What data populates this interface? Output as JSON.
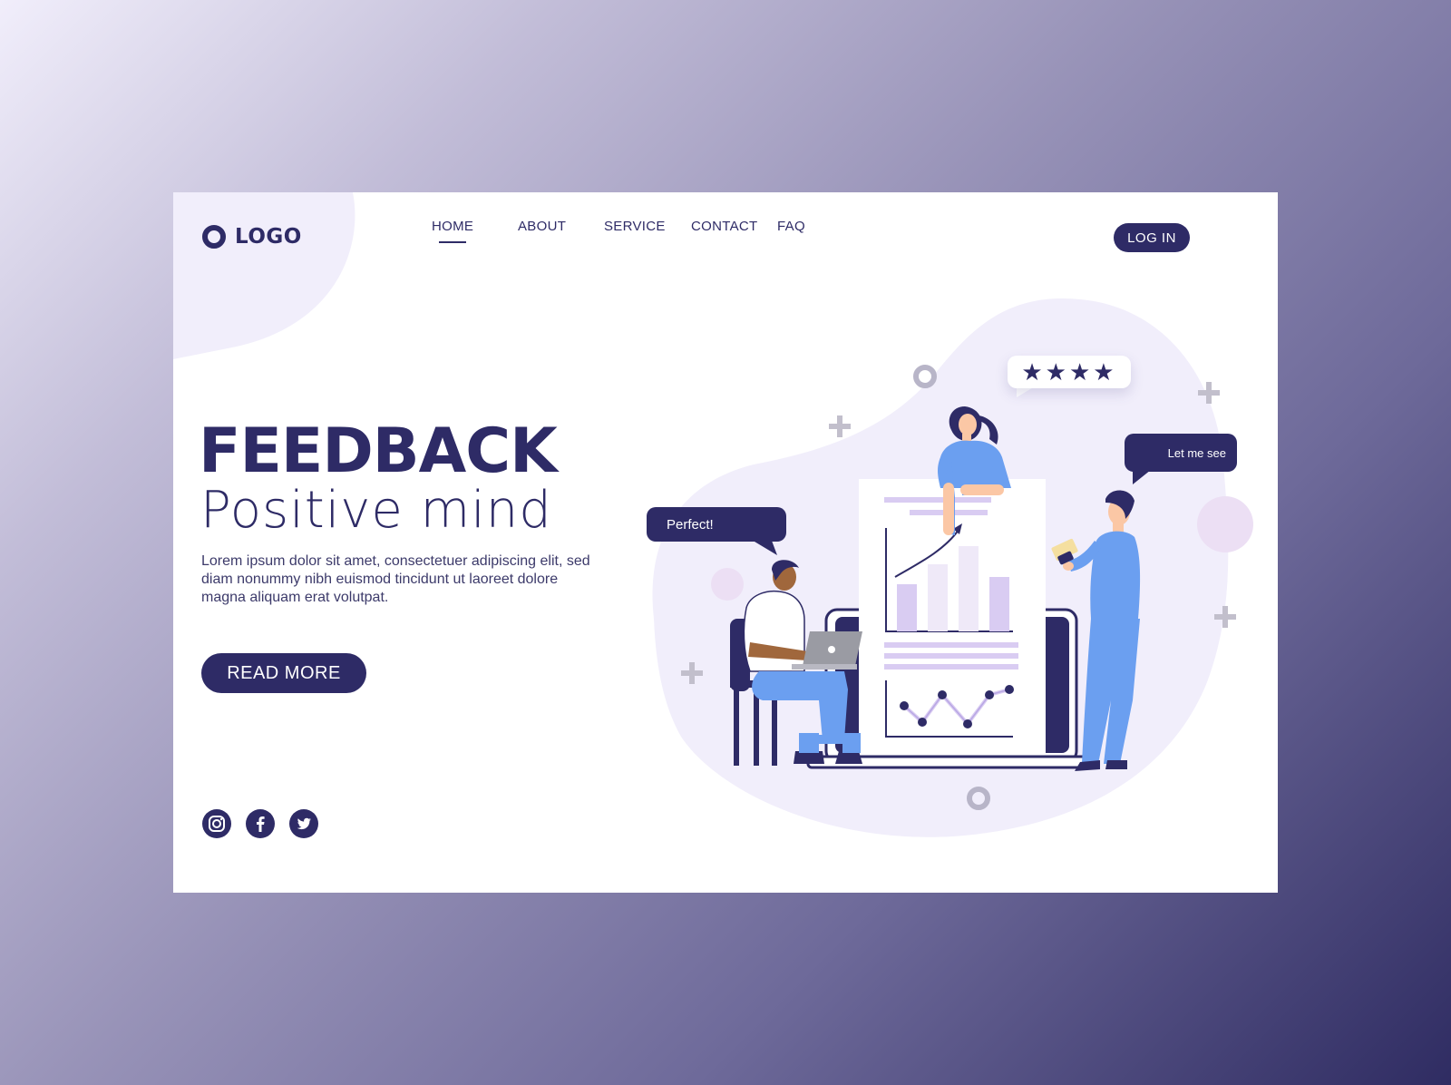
{
  "logo": {
    "text": "LOGO"
  },
  "nav": {
    "items": [
      "HOME",
      "ABOUT",
      "SERVICE",
      "CONTACT",
      "FAQ"
    ],
    "active": "HOME",
    "login_label": "LOG IN"
  },
  "hero": {
    "title": "FEEDBACK",
    "subtitle": "Positive mind",
    "description": "Lorem ipsum dolor sit amet, consectetuer adipiscing elit, sed diam nonummy nibh euismod tincidunt ut laoreet dolore magna aliquam erat volutpat.",
    "cta_label": "READ MORE"
  },
  "social": [
    "instagram-icon",
    "facebook-icon",
    "twitter-icon"
  ],
  "illustration": {
    "bubble_perfect": "Perfect!",
    "bubble_let_me_see": "Let me see",
    "rating_stars": "★★★★"
  },
  "colors": {
    "primary": "#2e2b66",
    "accent_blue": "#6b9ff0",
    "light_purple": "#f1eefb",
    "chart_purple": "#d9ccf2"
  }
}
